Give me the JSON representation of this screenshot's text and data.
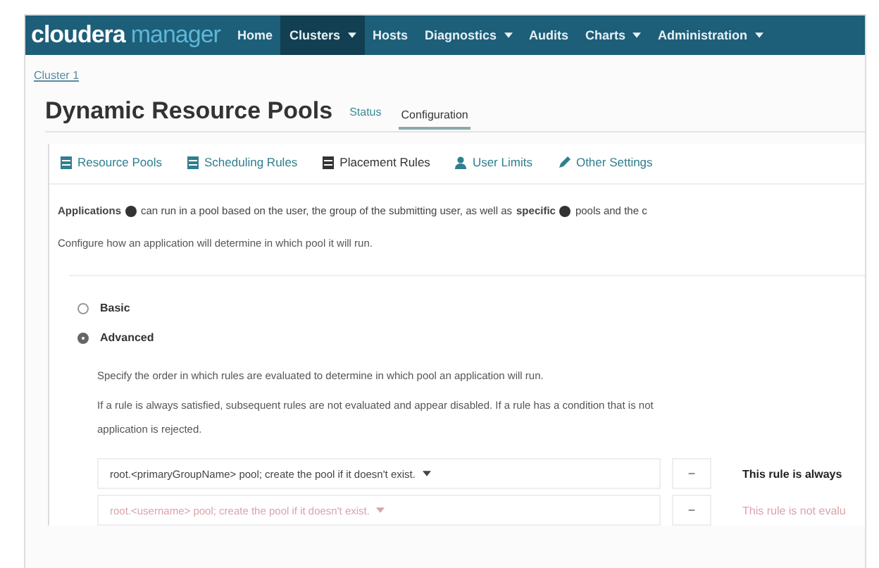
{
  "navbar": {
    "logo": {
      "brand": "cloudera",
      "product": "manager"
    },
    "items": [
      {
        "label": "Home",
        "selected": false,
        "dropdown": false
      },
      {
        "label": "Clusters",
        "selected": true,
        "dropdown": true
      },
      {
        "label": "Hosts",
        "selected": false,
        "dropdown": false
      },
      {
        "label": "Diagnostics",
        "selected": false,
        "dropdown": true
      },
      {
        "label": "Audits",
        "selected": false,
        "dropdown": false
      },
      {
        "label": "Charts",
        "selected": false,
        "dropdown": true
      },
      {
        "label": "Administration",
        "selected": false,
        "dropdown": true
      }
    ]
  },
  "breadcrumb": "Cluster 1",
  "page_title": "Dynamic Resource Pools",
  "tabs": [
    {
      "label": "Status",
      "selected": false
    },
    {
      "label": "Configuration",
      "selected": true
    }
  ],
  "subtabs": [
    {
      "label": "Resource Pools",
      "kind": "list",
      "selected": false
    },
    {
      "label": "Scheduling Rules",
      "kind": "list",
      "selected": false
    },
    {
      "label": "Placement Rules",
      "kind": "list",
      "selected": true
    },
    {
      "label": "User Limits",
      "kind": "user",
      "selected": false
    },
    {
      "label": "Other Settings",
      "kind": "pencil",
      "selected": false
    }
  ],
  "intro": [
    {
      "kind": "bold",
      "text": "Applications"
    },
    {
      "kind": "help"
    },
    {
      "kind": "text",
      "text": "can run in a pool based on the user, the group of the submitting user, as well as"
    },
    {
      "kind": "bold",
      "text": "specific"
    },
    {
      "kind": "help"
    },
    {
      "kind": "text",
      "text": "pools and the c"
    }
  ],
  "configure_text": "Configure how an application will determine in which pool it will run.",
  "modes": [
    {
      "label": "Basic",
      "selected": false
    },
    {
      "label": "Advanced",
      "selected": true
    }
  ],
  "order_text": "Specify the order in which rules are evaluated to determine in which pool an application will run.",
  "rule_note": "If a rule is always satisfied, subsequent rules are not evaluated and appear disabled. If a rule has a condition that is not",
  "rule_note_end": "application is rejected.",
  "rules": [
    {
      "text": "root.<primaryGroupName> pool; create the pool if it doesn't exist.",
      "disabled": false,
      "remove": "−",
      "note": "This rule is always"
    },
    {
      "text": "root.<username> pool; create the pool if it doesn't exist.",
      "disabled": true,
      "remove": "−",
      "note": "This rule is not evalu"
    }
  ]
}
